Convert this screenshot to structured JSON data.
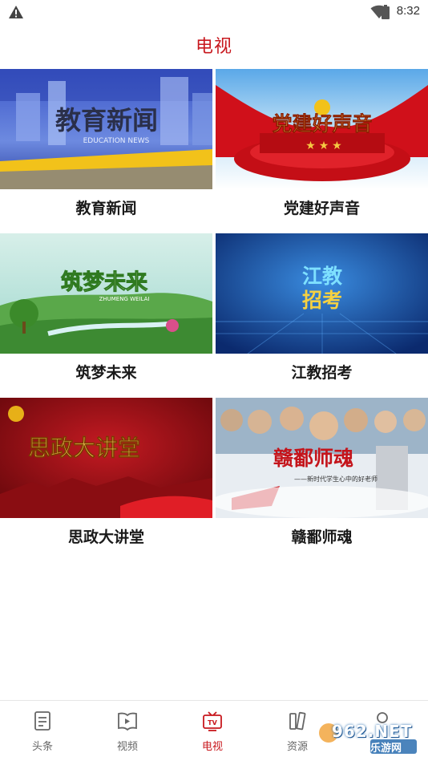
{
  "status_bar": {
    "time": "8:32"
  },
  "header": {
    "title": "电视"
  },
  "programs": [
    {
      "name": "教育新闻",
      "thumb_text": "教育新闻",
      "thumb_sub": "EDUCATION NEWS"
    },
    {
      "name": "党建好声音",
      "thumb_text": "党建好声音"
    },
    {
      "name": "筑梦未来",
      "thumb_text": "筑梦未来",
      "thumb_sub": "ZHUMENG WEILAI"
    },
    {
      "name": "江教招考",
      "thumb_text_line1": "江教",
      "thumb_text_line2": "招考"
    },
    {
      "name": "思政大讲堂",
      "thumb_text": "思政大讲堂"
    },
    {
      "name": "赣鄱师魂",
      "thumb_text": "赣鄱师魂",
      "thumb_sub": "——新时代学生心中的好老师"
    }
  ],
  "tabbar": {
    "items": [
      {
        "label": "头条",
        "icon": "document-icon",
        "active": false
      },
      {
        "label": "视频",
        "icon": "video-book-icon",
        "active": false
      },
      {
        "label": "电视",
        "icon": "tv-icon",
        "active": true
      },
      {
        "label": "资源",
        "icon": "resources-icon",
        "active": false
      },
      {
        "label": "",
        "icon": "profile-icon",
        "active": false
      }
    ]
  },
  "watermark": {
    "text": "962.NET",
    "sub": "乐游网"
  },
  "colors": {
    "accent": "#c8181e",
    "tab_inactive": "#666666"
  }
}
